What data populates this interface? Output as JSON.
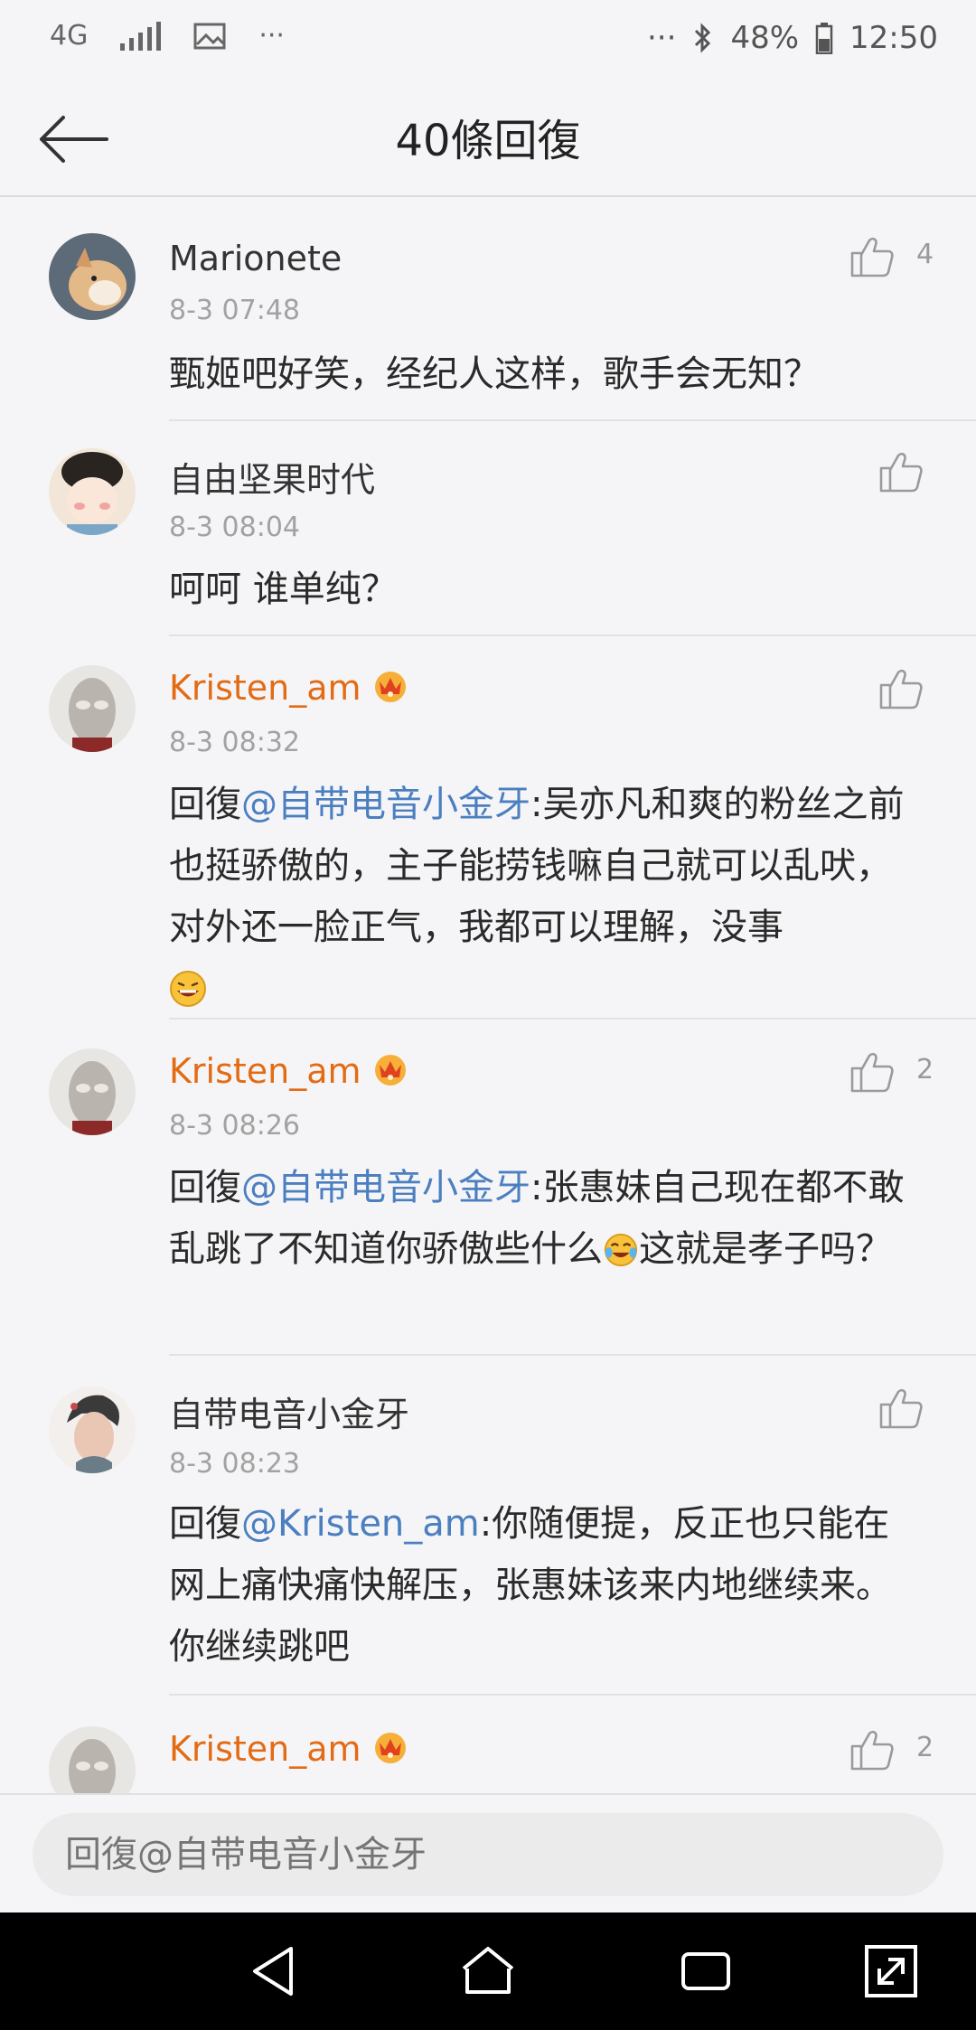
{
  "status_bar": {
    "network": "4G",
    "dots_left": "···",
    "dots_right": "···",
    "battery": "48%",
    "time": "12:50"
  },
  "header": {
    "title": "40條回復",
    "back_icon": "arrow-left-icon"
  },
  "comments": [
    {
      "user": "Marionete",
      "vip": false,
      "time": "8-3 07:48",
      "likes": "4",
      "text": "甄姬吧好笑，经纪人这样，歌手会无知？"
    },
    {
      "user": "自由坚果时代",
      "vip": false,
      "time": "8-3 08:04",
      "likes": "",
      "text": "呵呵 谁单纯？"
    },
    {
      "user": "Kristen_am",
      "vip": true,
      "time": "8-3 08:32",
      "likes": "",
      "reply_prefix": "回復",
      "mention": "@自带电音小金牙",
      "text": ":吴亦凡和爽的粉丝之前也挺骄傲的，主子能捞钱嘛自己就可以乱吠，对外还一脸正气，我都可以理解，没事"
    },
    {
      "user": "Kristen_am",
      "vip": true,
      "time": "8-3 08:26",
      "likes": "2",
      "reply_prefix": "回復",
      "mention": "@自带电音小金牙",
      "text": ":张惠妹自己现在都不敢乱跳了不知道你骄傲些什么",
      "text_after_emoji": "这就是孝子吗？"
    },
    {
      "user": "自带电音小金牙",
      "vip": false,
      "time": "8-3 08:23",
      "likes": "",
      "reply_prefix": "回復",
      "mention": "@Kristen_am",
      "text": ":你随便提，反正也只能在网上痛快痛快解压，张惠妹该来内地继续来。你继续跳吧"
    },
    {
      "user": "Kristen_am",
      "vip": true,
      "likes": "2"
    }
  ],
  "reply_box": {
    "placeholder": "回復@自带电音小金牙"
  },
  "colors": {
    "vip_name": "#e36b14",
    "mention": "#4b7fc0",
    "background": "#f5f5f7"
  }
}
